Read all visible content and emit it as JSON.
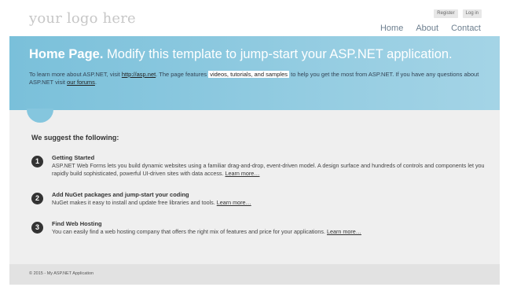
{
  "header": {
    "logo": "your logo here",
    "login": {
      "register_label": "Register",
      "login_label": "Log in"
    },
    "nav": [
      {
        "label": "Home"
      },
      {
        "label": "About"
      },
      {
        "label": "Contact"
      }
    ]
  },
  "featured": {
    "title_strong": "Home Page.",
    "title_rest": " Modify this template to jump-start your ASP.NET application.",
    "text_1": "To learn more about ASP.NET, visit ",
    "link_aspnet": "http://asp.net",
    "text_2": ". The page features ",
    "mark_text": "videos, tutorials, and samples",
    "text_3": " to help you get the most from ASP.NET. If you have any questions about ASP.NET visit ",
    "link_forums": "our forums",
    "text_4": "."
  },
  "main": {
    "suggest_title": "We suggest the following:",
    "steps": [
      {
        "number": "1",
        "heading": "Getting Started",
        "body": "ASP.NET Web Forms lets you build dynamic websites using a familiar drag-and-drop, event-driven model. A design surface and hundreds of controls and components let you rapidly build sophisticated, powerful UI-driven sites with data access. ",
        "link": "Learn more…"
      },
      {
        "number": "2",
        "heading": "Add NuGet packages and jump-start your coding",
        "body": "NuGet makes it easy to install and update free libraries and tools. ",
        "link": "Learn more…"
      },
      {
        "number": "3",
        "heading": "Find Web Hosting",
        "body": "You can easily find a web hosting company that offers the right mix of features and price for your applications. ",
        "link": "Learn more…"
      }
    ]
  },
  "footer": {
    "text": "© 2015 - My ASP.NET Application"
  },
  "colors": {
    "banner_start": "#7ac0da",
    "banner_end": "#a4d4e6",
    "body_bg": "#efefef",
    "footer_bg": "#e2e2e2",
    "nav_text": "#6d7f8f",
    "logo_text": "#c7c7c7"
  }
}
